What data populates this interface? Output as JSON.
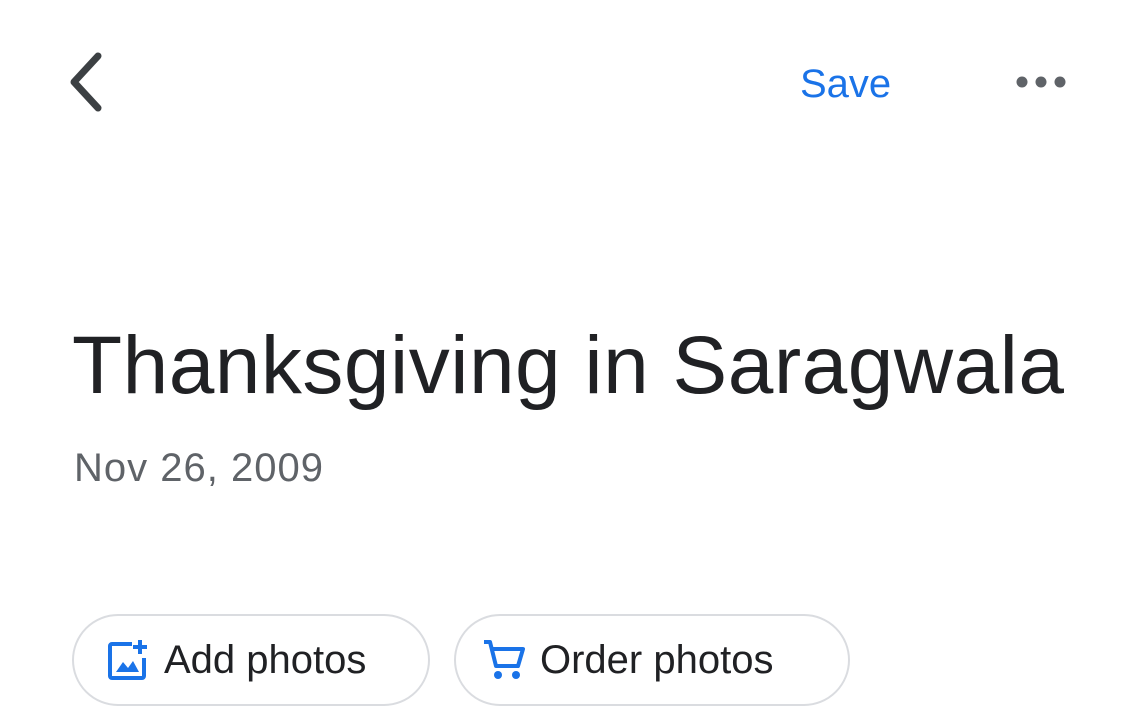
{
  "header": {
    "save_label": "Save",
    "back_icon": "chevron-left-icon",
    "more_icon": "more-horizontal-icon"
  },
  "album": {
    "title": "Thanksgiving in Saragwala",
    "date": "Nov 26, 2009"
  },
  "actions": [
    {
      "label": "Add photos",
      "icon": "add-photo-icon"
    },
    {
      "label": "Order photos",
      "icon": "shopping-cart-icon"
    }
  ],
  "colors": {
    "accent": "#1a73e8",
    "title_text": "#202124",
    "secondary_text": "#5f6368",
    "chip_border": "#dadce0",
    "icon_gray": "#3c4043"
  }
}
